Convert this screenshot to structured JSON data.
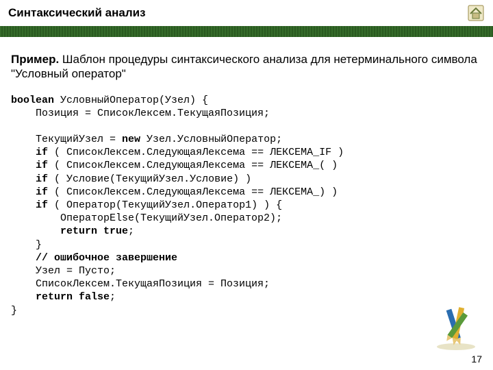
{
  "header": {
    "title": "Синтаксический анализ"
  },
  "desc": {
    "lead": "Пример.",
    "rest": " Шаблон процедуры синтаксического анализа для нетерминального символа \"Условный оператор\""
  },
  "code": {
    "l01a": "boolean",
    "l01b": " УсловныйОператор(Узел) {",
    "l02": "    Позиция = СписокЛексем.ТекущаяПозиция;",
    "l03": "",
    "l04a": "    ТекущийУзел = ",
    "l04b": "new",
    "l04c": " Узел.УсловныйОператор;",
    "l05a": "    ",
    "l05b": "if",
    "l05c": " ( СписокЛексем.СледующаяЛексема == ЛЕКСЕМА_IF )",
    "l06a": "    ",
    "l06b": "if",
    "l06c": " ( СписокЛексем.СледующаяЛексема == ЛЕКСЕМА_( )",
    "l07a": "    ",
    "l07b": "if",
    "l07c": " ( Условие(ТекущийУзел.Условие) )",
    "l08a": "    ",
    "l08b": "if",
    "l08c": " ( СписокЛексем.СледующаяЛексема == ЛЕКСЕМА_) )",
    "l09a": "    ",
    "l09b": "if",
    "l09c": " ( Оператор(ТекущийУзел.Оператор1) ) {",
    "l10": "        ОператорElse(ТекущийУзел.Оператор2);",
    "l11a": "        ",
    "l11b": "return true",
    "l11c": ";",
    "l12": "    }",
    "l13": "    // ошибочное завершение",
    "l14": "    Узел = Пусто;",
    "l15": "    СписокЛексем.ТекущаяПозиция = Позиция;",
    "l16a": "    ",
    "l16b": "return false",
    "l16c": ";",
    "l17": "}"
  },
  "page_number": "17"
}
